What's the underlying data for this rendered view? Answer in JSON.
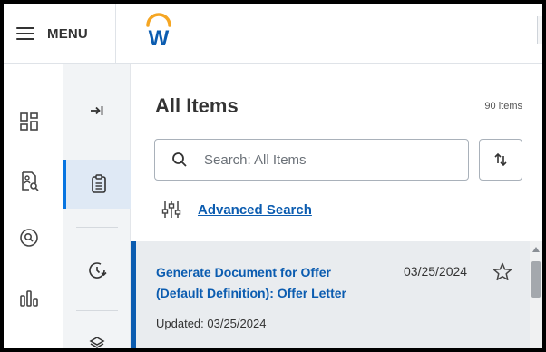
{
  "topbar": {
    "menu_label": "MENU",
    "logo_letter": "W"
  },
  "rail": {
    "items": [
      {
        "icon": "apps-grid-icon"
      },
      {
        "icon": "person-document-search-icon"
      },
      {
        "icon": "search-circle-icon"
      },
      {
        "icon": "bar-chart-icon"
      }
    ]
  },
  "side_panel": {
    "items": [
      {
        "icon": "expand-arrow-icon"
      },
      {
        "icon": "clipboard-icon",
        "active": true
      },
      {
        "icon": "history-clock-icon"
      },
      {
        "icon": "layers-icon"
      }
    ]
  },
  "main": {
    "title": "All Items",
    "count": "90 items",
    "search": {
      "placeholder": "Search: All Items",
      "value": ""
    },
    "advanced_search_label": "Advanced Search"
  },
  "results": [
    {
      "title": "Generate Document for Offer (Default Definition): Offer Letter",
      "date": "03/25/2024",
      "updated": "Updated: 03/25/2024"
    }
  ],
  "colors": {
    "accent": "#0b5cb0",
    "active_bg": "#dfe9f5",
    "logo_orange": "#f5a623",
    "logo_blue": "#0b5cb0"
  }
}
